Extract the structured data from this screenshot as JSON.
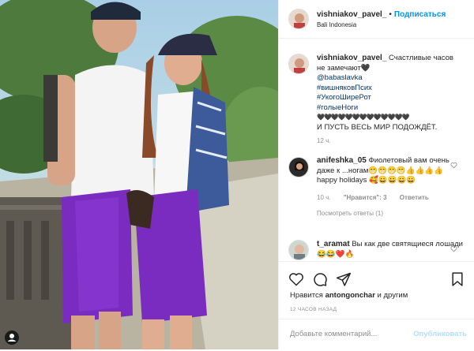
{
  "post": {
    "username": "vishniakov_pavel_",
    "follow_label": "Подписаться",
    "location": "Bali Indonesia"
  },
  "caption": {
    "username": "vishniakov_pavel_",
    "text": "Счастливые часов не замечают🖤",
    "mention": "@babaslavka",
    "hashtags": [
      "#вишняковПсих",
      "#УкогоШиреРот",
      "#голыеНоги"
    ],
    "hearts": "🖤🖤🖤🖤🖤🖤🖤🖤🖤🖤🖤🖤🖤",
    "tail": "И ПУСТЬ ВЕСЬ МИР ПОДОЖДЁТ.",
    "time": "12 ч."
  },
  "comments": [
    {
      "username": "anifeshka_05",
      "text": "Фиолетовый вам очень даже к ...ногам😁😁😁😁👍👍👍👍 happy holidays 🥰😀😀😀😀",
      "time": "10 ч.",
      "likes_label": "\"Нравится\": 3",
      "reply_label": "Ответить",
      "view_replies": "Посмотреть ответы (1)"
    },
    {
      "username": "t_aramat",
      "text": "Вы как две святящиеся лошади😂😂❤️🔥"
    }
  ],
  "actions": {
    "liked_by_prefix": "Нравится",
    "liked_by_user": "antongonchar",
    "liked_by_suffix": "и другим",
    "date": "12 ЧАСОВ НАЗАД"
  },
  "add_comment": {
    "placeholder": "Добавьте комментарий...",
    "publish_label": "Опубликовать"
  },
  "colors": {
    "link_blue": "#0095f6",
    "hashtag": "#00376b",
    "skirt_purple": "#7a2cc0",
    "muted": "#8e8e8e"
  }
}
